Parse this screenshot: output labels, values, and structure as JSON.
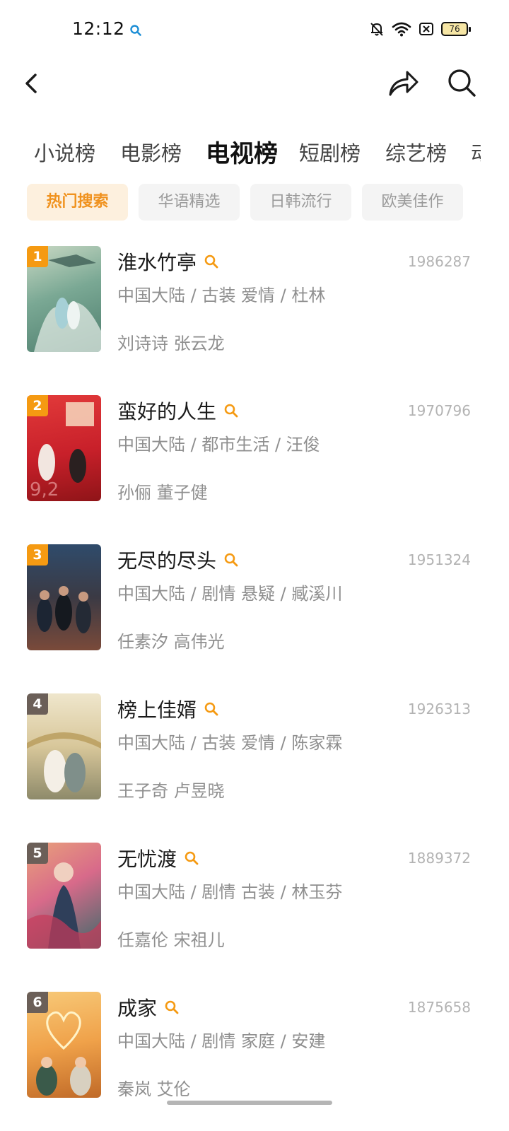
{
  "status_bar": {
    "time": "12:12",
    "icons": [
      "search-icon",
      "mute-bell-icon",
      "wifi-icon",
      "sim-off-icon",
      "battery-icon"
    ],
    "battery": "76"
  },
  "header": {
    "icons": [
      "back-arrow-icon",
      "share-icon",
      "search-icon"
    ]
  },
  "category_tabs": [
    {
      "label": "小说榜",
      "active": false
    },
    {
      "label": "电影榜",
      "active": false
    },
    {
      "label": "电视榜",
      "active": true
    },
    {
      "label": "短剧榜",
      "active": false
    },
    {
      "label": "综艺榜",
      "active": false
    },
    {
      "label": "动",
      "active": false
    }
  ],
  "sub_tabs": [
    {
      "label": "热门搜索",
      "active": true
    },
    {
      "label": "华语精选",
      "active": false
    },
    {
      "label": "日韩流行",
      "active": false
    },
    {
      "label": "欧美佳作",
      "active": false
    }
  ],
  "accent_color": "#f59a12",
  "items": [
    {
      "rank": "1",
      "title": "淮水竹亭",
      "count": "1986287",
      "meta": "中国大陆 / 古装 爱情 / 杜林",
      "cast": "刘诗诗 张云龙",
      "poster_colors": [
        "#7aa894",
        "#c9d9c4",
        "#4d7d6d"
      ]
    },
    {
      "rank": "2",
      "title": "蛮好的人生",
      "count": "1970796",
      "meta": "中国大陆 / 都市生活 / 汪俊",
      "cast": "孙俪 董子健",
      "poster_colors": [
        "#c8202a",
        "#e23a3a",
        "#8f1418"
      ]
    },
    {
      "rank": "3",
      "title": "无尽的尽头",
      "count": "1951324",
      "meta": "中国大陆 / 剧情 悬疑 / 臧溪川",
      "cast": "任素汐 高伟光",
      "poster_colors": [
        "#2f4b6b",
        "#7a4a3a",
        "#1c2533"
      ]
    },
    {
      "rank": "4",
      "title": "榜上佳婿",
      "count": "1926313",
      "meta": "中国大陆 / 古装 爱情 / 陈家霖",
      "cast": "王子奇 卢昱晓",
      "poster_colors": [
        "#d8c79a",
        "#8e8a6a",
        "#efe6cc"
      ]
    },
    {
      "rank": "5",
      "title": "无忧渡",
      "count": "1889372",
      "meta": "中国大陆 / 剧情 古装 / 林玉芬",
      "cast": "任嘉伦 宋祖儿",
      "poster_colors": [
        "#d86a8a",
        "#3c6a6a",
        "#e9a27a"
      ]
    },
    {
      "rank": "6",
      "title": "成家",
      "count": "1875658",
      "meta": "中国大陆 / 剧情 家庭 / 安建",
      "cast": "秦岚 艾伦",
      "poster_colors": [
        "#f0a24a",
        "#f7c978",
        "#c06a28"
      ]
    }
  ]
}
